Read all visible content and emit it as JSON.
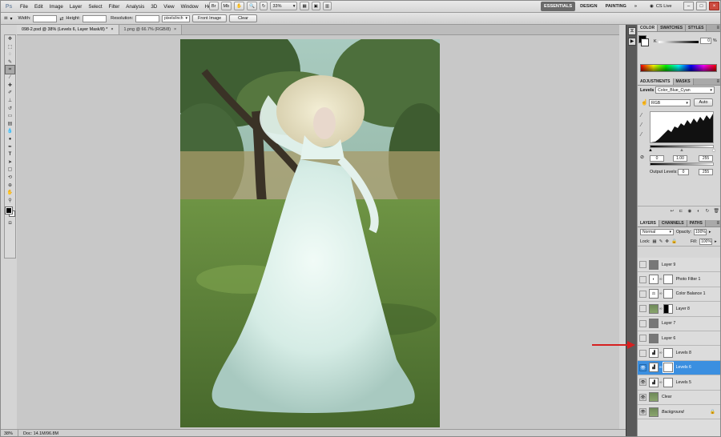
{
  "app": {
    "logo": "Ps",
    "menus": [
      "File",
      "Edit",
      "Image",
      "Layer",
      "Select",
      "Filter",
      "Analysis",
      "3D",
      "View",
      "Window",
      "Help"
    ],
    "zoom_select": "33%",
    "workspaces": [
      "ESSENTIALS",
      "DESIGN",
      "PAINTING"
    ],
    "more": "»",
    "cs_live": "CS Live"
  },
  "options": {
    "width_label": "Width:",
    "height_label": "Height:",
    "resolution_label": "Resolution:",
    "unit": "pixels/inch",
    "front_image": "Front Image",
    "clear": "Clear"
  },
  "tabs": [
    {
      "label": "098-2.psd @ 38% (Levels 6, Layer Mask/8) *",
      "active": true
    },
    {
      "label": "1.png @ 66.7% (RGB/8)",
      "active": false
    }
  ],
  "status": {
    "zoom": "38%",
    "doc": "Doc: 14.1M/96.8M"
  },
  "panels": {
    "color_tabs": [
      "COLOR",
      "SWATCHES",
      "STYLES"
    ],
    "color": {
      "channel": "K",
      "value": "0",
      "unit": "%"
    },
    "adjust_tabs": [
      "ADJUSTMENTS",
      "MASKS"
    ],
    "adjust": {
      "name": "Levels",
      "preset": "Color_Blue_Cyan",
      "channel": "RGB",
      "auto": "Auto",
      "input_black": "0",
      "input_gamma": "1.00",
      "input_white": "255",
      "output_label": "Output Levels:",
      "output_black": "0",
      "output_white": "255"
    },
    "layer_tabs": [
      "LAYERS",
      "CHANNELS",
      "PATHS"
    ],
    "layers_opts": {
      "blend": "Normal",
      "opacity_label": "Opacity:",
      "opacity": "100%",
      "lock_label": "Lock:",
      "fill_label": "Fill:",
      "fill": "100%"
    },
    "layers": [
      {
        "name": "Layer 9",
        "visible": false,
        "kind": "gray"
      },
      {
        "name": "Photo Filter 1",
        "visible": false,
        "kind": "adj"
      },
      {
        "name": "Color Balance 1",
        "visible": false,
        "kind": "adj"
      },
      {
        "name": "Layer 8",
        "visible": false,
        "kind": "photo-mask"
      },
      {
        "name": "Layer 7",
        "visible": false,
        "kind": "gray"
      },
      {
        "name": "Layer 6",
        "visible": false,
        "kind": "gray"
      },
      {
        "name": "Levels 8",
        "visible": false,
        "kind": "adj"
      },
      {
        "name": "Levels 6",
        "visible": true,
        "kind": "adj",
        "selected": true
      },
      {
        "name": "Levels 5",
        "visible": true,
        "kind": "adj"
      },
      {
        "name": "Clear",
        "visible": true,
        "kind": "photo"
      },
      {
        "name": "Background",
        "visible": true,
        "kind": "photo",
        "locked": true
      }
    ]
  },
  "colors": {
    "arrow": "#d62020",
    "selected_layer": "#3b8fe0"
  }
}
